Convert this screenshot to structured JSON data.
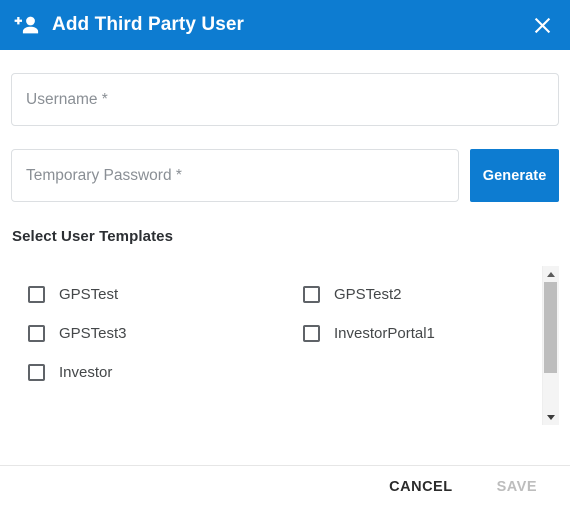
{
  "dialog": {
    "title": "Add Third Party User",
    "header_icon": "person-add-icon",
    "close_icon": "close-icon",
    "accent_color": "#0d7cd1"
  },
  "form": {
    "username": {
      "placeholder": "Username *",
      "value": ""
    },
    "password": {
      "placeholder": "Temporary Password *",
      "value": ""
    },
    "generate_label": "Generate"
  },
  "templates_section": {
    "heading": "Select User Templates",
    "items": [
      {
        "label": "GPSTest",
        "checked": false
      },
      {
        "label": "GPSTest2",
        "checked": false
      },
      {
        "label": "GPSTest3",
        "checked": false
      },
      {
        "label": "InvestorPortal1",
        "checked": false
      },
      {
        "label": "Investor",
        "checked": false
      }
    ],
    "scrollbar": {
      "up_icon": "scroll-up-arrow-icon",
      "down_icon": "scroll-down-arrow-icon"
    }
  },
  "footer": {
    "cancel_label": "CANCEL",
    "save_label": "SAVE",
    "save_disabled": true
  }
}
